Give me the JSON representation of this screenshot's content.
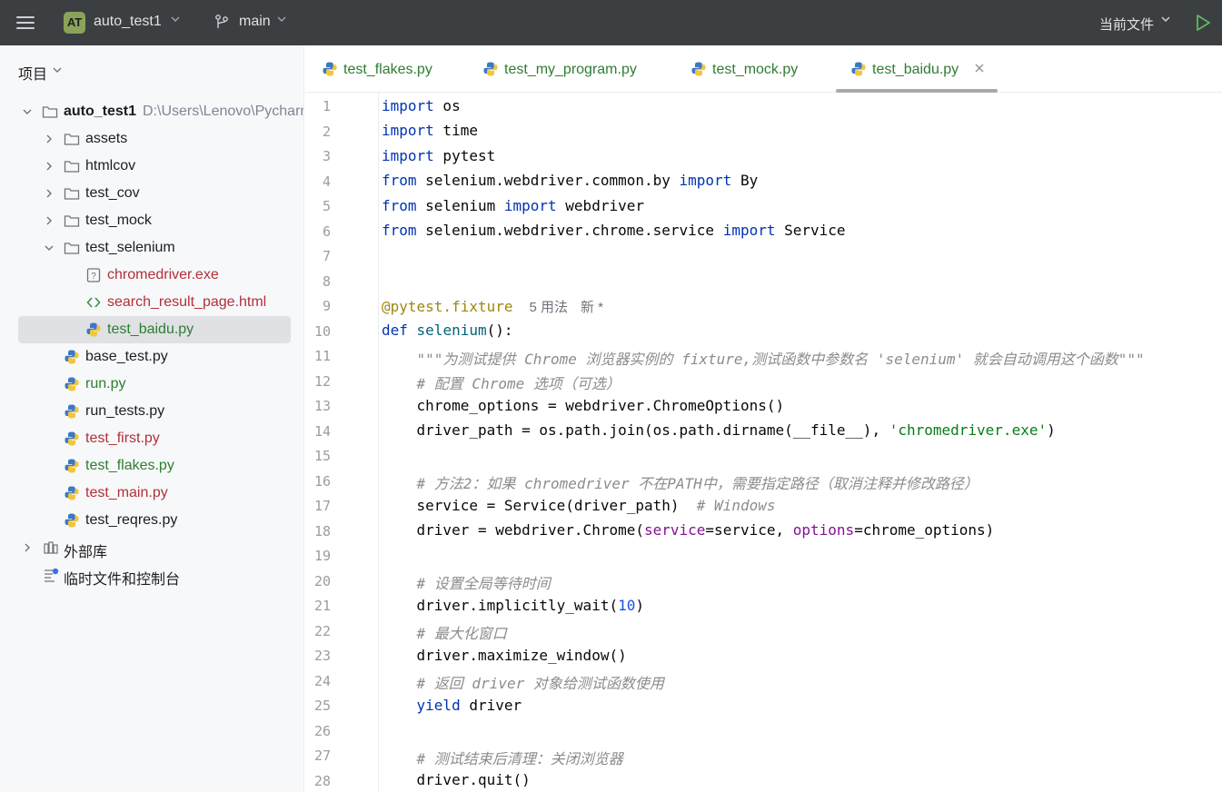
{
  "topbar": {
    "project_badge": "AT",
    "project_name": "auto_test1",
    "branch_name": "main",
    "run_config": "当前文件"
  },
  "sidebar": {
    "header": "项目",
    "root": {
      "name": "auto_test1",
      "path": "D:\\Users\\Lenovo\\Pycharm"
    },
    "items": [
      {
        "label": "assets",
        "type": "folder"
      },
      {
        "label": "htmlcov",
        "type": "folder"
      },
      {
        "label": "test_cov",
        "type": "folder"
      },
      {
        "label": "test_mock",
        "type": "folder"
      },
      {
        "label": "test_selenium",
        "type": "folder"
      },
      {
        "label": "chromedriver.exe",
        "type": "unknown"
      },
      {
        "label": "search_result_page.html",
        "type": "html"
      },
      {
        "label": "test_baidu.py",
        "type": "python"
      },
      {
        "label": "base_test.py",
        "type": "python"
      },
      {
        "label": "run.py",
        "type": "python"
      },
      {
        "label": "run_tests.py",
        "type": "python"
      },
      {
        "label": "test_first.py",
        "type": "python"
      },
      {
        "label": "test_flakes.py",
        "type": "python"
      },
      {
        "label": "test_main.py",
        "type": "python"
      },
      {
        "label": "test_reqres.py",
        "type": "python"
      },
      {
        "label": "外部库",
        "type": "library"
      },
      {
        "label": "临时文件和控制台",
        "type": "scratch"
      }
    ]
  },
  "tabs": [
    {
      "label": "test_flakes.py"
    },
    {
      "label": "test_my_program.py"
    },
    {
      "label": "test_mock.py"
    },
    {
      "label": "test_baidu.py"
    }
  ],
  "editor": {
    "line_numbers": [
      "1",
      "2",
      "3",
      "4",
      "5",
      "6",
      "7",
      "8",
      "9",
      "10",
      "11",
      "12",
      "13",
      "14",
      "15",
      "16",
      "17",
      "18",
      "19",
      "20",
      "21",
      "22",
      "23",
      "24",
      "25",
      "26",
      "27",
      "28"
    ],
    "hints": {
      "usages": "5 用法",
      "new": "新 *"
    },
    "tokens": {
      "l1_kw": "import",
      "l1_rest": " os",
      "l2_kw": "import",
      "l2_rest": " time",
      "l3_kw": "import",
      "l3_rest": " pytest",
      "l4_kw1": "from",
      "l4_mid": " selenium.webdriver.common.by ",
      "l4_kw2": "import",
      "l4_rest": " By",
      "l5_kw1": "from",
      "l5_mid": " selenium ",
      "l5_kw2": "import",
      "l5_rest": " webdriver",
      "l6_kw1": "from",
      "l6_mid": " selenium.webdriver.chrome.service ",
      "l6_kw2": "import",
      "l6_rest": " Service",
      "l9_dec": "@pytest.fixture",
      "l10_kw": "def",
      "l10_fn": " selenium",
      "l10_rest": "():",
      "l11_doc": "    \"\"\"为测试提供 Chrome 浏览器实例的 fixture,测试函数中参数名 'selenium' 就会自动调用这个函数\"\"\"",
      "l12_cm": "    # 配置 Chrome 选项（可选）",
      "l13": "    chrome_options = webdriver.ChromeOptions()",
      "l14_a": "    driver_path = os.path.join(os.path.dirname(__file__), ",
      "l14_str": "'chromedriver.exe'",
      "l14_b": ")",
      "l16_cm": "    # 方法2：如果 chromedriver 不在PATH中，需要指定路径（取消注释并修改路径）",
      "l17_a": "    service = Service(driver_path)  ",
      "l17_cm": "# Windows",
      "l18_a": "    driver = webdriver.Chrome(",
      "l18_p1": "service",
      "l18_b": "=service, ",
      "l18_p2": "options",
      "l18_c": "=chrome_options)",
      "l20_cm": "    # 设置全局等待时间",
      "l21_a": "    driver.implicitly_wait(",
      "l21_num": "10",
      "l21_b": ")",
      "l22_cm": "    # 最大化窗口",
      "l23": "    driver.maximize_window()",
      "l24_cm": "    # 返回 driver 对象给测试函数使用",
      "l25_kw": "    yield",
      "l25_rest": " driver",
      "l27_cm": "    # 测试结束后清理：关闭浏览器",
      "l28": "    driver.quit()"
    }
  },
  "colors": {
    "topbar_bg": "#3c3f41",
    "keyword": "#0033b3",
    "string": "#067d17",
    "comment": "#8c8c8c",
    "file_modified": "#2f7d32",
    "file_unversioned": "#b0303a"
  }
}
